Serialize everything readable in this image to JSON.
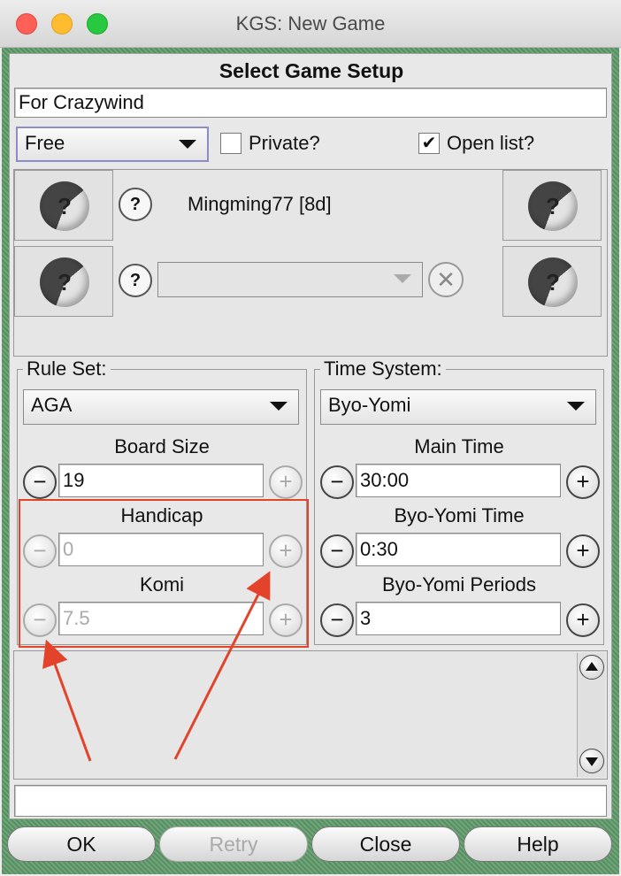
{
  "window": {
    "title": "KGS: New Game"
  },
  "dialog": {
    "title": "Select Game Setup",
    "description": "For Crazywind",
    "game_type": "Free",
    "private_label": "Private?",
    "private_checked": false,
    "open_list_label": "Open list?",
    "open_list_checked": true,
    "check_glyph": "✔"
  },
  "players": {
    "question_glyph": "?",
    "clear_glyph": "✕",
    "row1_name": "Mingming77 [8d]",
    "row2_name": ""
  },
  "rules": {
    "label": "Rule Set:",
    "value": "AGA",
    "board_size_label": "Board Size",
    "board_size": "19",
    "handicap_label": "Handicap",
    "handicap": "0",
    "komi_label": "Komi",
    "komi": "7.5"
  },
  "time": {
    "label": "Time System:",
    "value": "Byo-Yomi",
    "main_time_label": "Main Time",
    "main_time": "30:00",
    "byo_yomi_time_label": "Byo-Yomi Time",
    "byo_yomi_time": "0:30",
    "byo_yomi_periods_label": "Byo-Yomi Periods",
    "byo_yomi_periods": "3"
  },
  "stepper": {
    "minus": "−",
    "plus": "+"
  },
  "buttons": {
    "ok": "OK",
    "retry": "Retry",
    "close": "Close",
    "help": "Help"
  },
  "colors": {
    "annotation": "#e2432a",
    "frame": "#5f9b6a"
  }
}
